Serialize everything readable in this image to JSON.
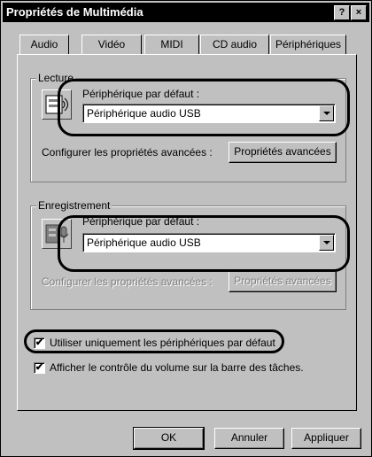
{
  "window": {
    "title": "Propriétés de Multimédia",
    "help_label": "?",
    "close_label": "×"
  },
  "tabs": [
    {
      "label": "Audio",
      "active": true
    },
    {
      "label": "Vidéo"
    },
    {
      "label": "MIDI"
    },
    {
      "label": "CD audio"
    },
    {
      "label": "Périphériques"
    }
  ],
  "lecture": {
    "legend": "Lecture",
    "device_label": "Périphérique par défaut :",
    "device_value": "Périphérique audio USB",
    "config_label": "Configurer les propriétés avancées :",
    "advanced_button": "Propriétés avancées",
    "icon": "speaker-icon"
  },
  "enregistrement": {
    "legend": "Enregistrement",
    "device_label": "Périphérique par défaut :",
    "device_value": "Périphérique audio USB",
    "config_label": "Configurer les propriétés avancées :",
    "advanced_button": "Propriétés avancées",
    "icon": "microphone-icon"
  },
  "options": {
    "use_default_only": {
      "label": "Utiliser uniquement les périphériques par défaut",
      "checked": true
    },
    "show_volume": {
      "label": "Afficher le contrôle du volume sur la barre des tâches.",
      "checked": true
    },
    "check_mark": "✔"
  },
  "footer": {
    "ok": "OK",
    "cancel": "Annuler",
    "apply": "Appliquer"
  }
}
